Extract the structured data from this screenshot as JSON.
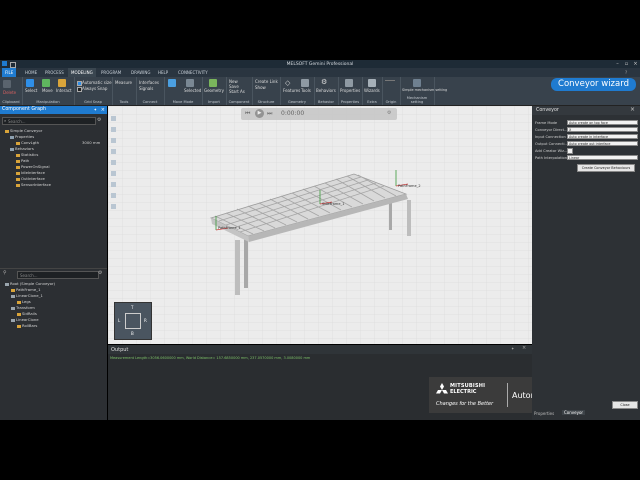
{
  "app": {
    "title": "MELSOFT Gemini Professional"
  },
  "menu": [
    "FILE",
    "HOME",
    "PROCESS",
    "MODELING",
    "PROGRAM",
    "DRAWING",
    "HELP",
    "CONNECTIVITY"
  ],
  "ribbon": {
    "groups": [
      {
        "label": "Clipboard"
      },
      {
        "label": "Manipulation"
      },
      {
        "label": "Grid Snap"
      },
      {
        "label": "Tools"
      },
      {
        "label": "Connect"
      },
      {
        "label": "Move Mode"
      },
      {
        "label": "Import"
      },
      {
        "label": "Component"
      },
      {
        "label": "Structure"
      },
      {
        "label": "Geometry"
      },
      {
        "label": "Behavior"
      },
      {
        "label": "Properties"
      },
      {
        "label": "Extra"
      },
      {
        "label": "Origin"
      },
      {
        "label": "Mechanism setting"
      }
    ],
    "items": {
      "delete": "Delete",
      "select": "Select",
      "move": "Move",
      "interact": "Interact",
      "automatic_size": "Automatic size",
      "always_snap": "Always Snap",
      "measure": "Measure",
      "interfaces": "Interfaces",
      "signals": "Signals",
      "selected": "Selected",
      "geometry": "Geometry",
      "new": "New",
      "save": "Save",
      "start_as": "Start As",
      "create_link": "Create Link",
      "show": "Show",
      "features": "Features",
      "tools": "Tools",
      "behaviors": "Behaviors",
      "properties": "Properties",
      "wizards": "Wizards",
      "simple_mechanism": "Simple mechanism setting"
    }
  },
  "wizard_badge": "Conveyor wizard",
  "component_graph": {
    "title": "Component Graph",
    "search_placeholder": "Search...",
    "tree": [
      {
        "label": "Simple Conveyor",
        "level": 0
      },
      {
        "label": "Properties",
        "level": 1
      },
      {
        "label": "ConvLgth",
        "value": "3000 mm",
        "level": 2
      },
      {
        "label": "Behaviors",
        "level": 1
      },
      {
        "label": "Statistics",
        "level": 2
      },
      {
        "label": "Path",
        "level": 2
      },
      {
        "label": "PowerOnSignal",
        "level": 2
      },
      {
        "label": "IdleInterface",
        "level": 2
      },
      {
        "label": "OutInterface",
        "level": 2
      },
      {
        "label": "SensorInterface",
        "level": 2
      }
    ],
    "tree2": [
      {
        "label": "Root (Simple Conveyor)",
        "level": 0
      },
      {
        "label": "PathFrame_1",
        "level": 1
      },
      {
        "label": "LinearClone_1",
        "level": 1
      },
      {
        "label": "Legs",
        "level": 2
      },
      {
        "label": "Transform",
        "level": 1
      },
      {
        "label": "SidRails",
        "level": 2
      },
      {
        "label": "LinearClone",
        "level": 1
      },
      {
        "label": "RollBars",
        "level": 2
      }
    ]
  },
  "viewport": {
    "sim_time": "0:00:00",
    "frame_labels": [
      "PathFrame_2",
      "PathFrame_1",
      "SideFrame_1"
    ],
    "nav": {
      "top": "T",
      "left": "L",
      "right": "R",
      "bottom": "B"
    }
  },
  "output": {
    "title": "Output",
    "line": "Measurement Length=3056.0600000 mm, World Distance= 157.6850000 mm, 237.0570000 mm, 3.0080000 mm"
  },
  "brand": {
    "name_line1": "MITSUBISHI",
    "name_line2": "ELECTRIC",
    "slogan": "Changes for the Better",
    "tagline": "Automating the World"
  },
  "conveyor_panel": {
    "title": "Conveyor",
    "fields": [
      {
        "label": "Frame Mode",
        "value": "Auto create on top face"
      },
      {
        "label": "Conveyor Direct...",
        "value": "X"
      },
      {
        "label": "Input Connection",
        "value": "Auto create in interface"
      },
      {
        "label": "Output Connecti...",
        "value": "Auto create out interface"
      },
      {
        "label": "Add Creator Wiz...",
        "value": ""
      },
      {
        "label": "Path Interpolation",
        "value": "Linear"
      }
    ],
    "create_button": "Create Conveyor Behaviours",
    "close_button": "Close",
    "tabs": [
      "Properties",
      "Conveyor"
    ]
  },
  "colors": {
    "accent": "#1f7bd0",
    "output_text": "#7ec46a"
  }
}
